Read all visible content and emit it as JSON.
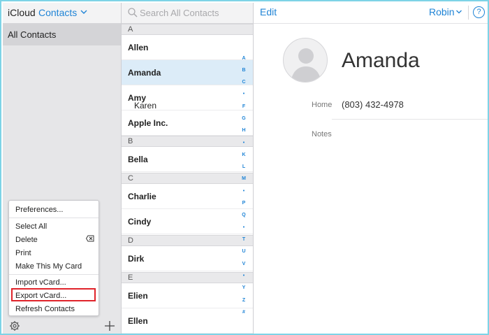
{
  "groups": {
    "brand": "iCloud",
    "app": "Contacts",
    "all_contacts": "All Contacts"
  },
  "menu": {
    "items": [
      "Preferences...",
      "Select All",
      "Delete",
      "Print",
      "Make This My Card",
      "Import vCard...",
      "Export vCard...",
      "Refresh Contacts"
    ]
  },
  "search": {
    "placeholder": "Search All Contacts"
  },
  "sections": [
    "A",
    "B",
    "C",
    "D",
    "E"
  ],
  "contacts": [
    {
      "first": "",
      "last": "Allen"
    },
    {
      "first": "",
      "last": "Amanda"
    },
    {
      "first": "Karen",
      "last": "Amy"
    },
    {
      "first": "",
      "last": "Apple Inc."
    },
    {
      "first": "",
      "last": "Bella"
    },
    {
      "first": "",
      "last": "Charlie"
    },
    {
      "first": "",
      "last": "Cindy"
    },
    {
      "first": "",
      "last": "Dirk"
    },
    {
      "first": "",
      "last": "Elien"
    },
    {
      "first": "",
      "last": "Ellen"
    }
  ],
  "index_letters": [
    "A",
    "B",
    "C",
    "•",
    "F",
    "G",
    "H",
    "•",
    "K",
    "L",
    "M",
    "•",
    "P",
    "Q",
    "•",
    "T",
    "U",
    "V",
    "•",
    "Y",
    "Z",
    "#"
  ],
  "detail": {
    "edit_label": "Edit",
    "user_name": "Robin",
    "help": "?",
    "contact_name": "Amanda",
    "home_label": "Home",
    "home_value": "(803) 432-4978",
    "notes_label": "Notes"
  },
  "colors": {
    "accent": "#1f84d6",
    "frame": "#7ed3e6",
    "highlight": "#e0232a",
    "selected_row": "#dcecf8"
  }
}
